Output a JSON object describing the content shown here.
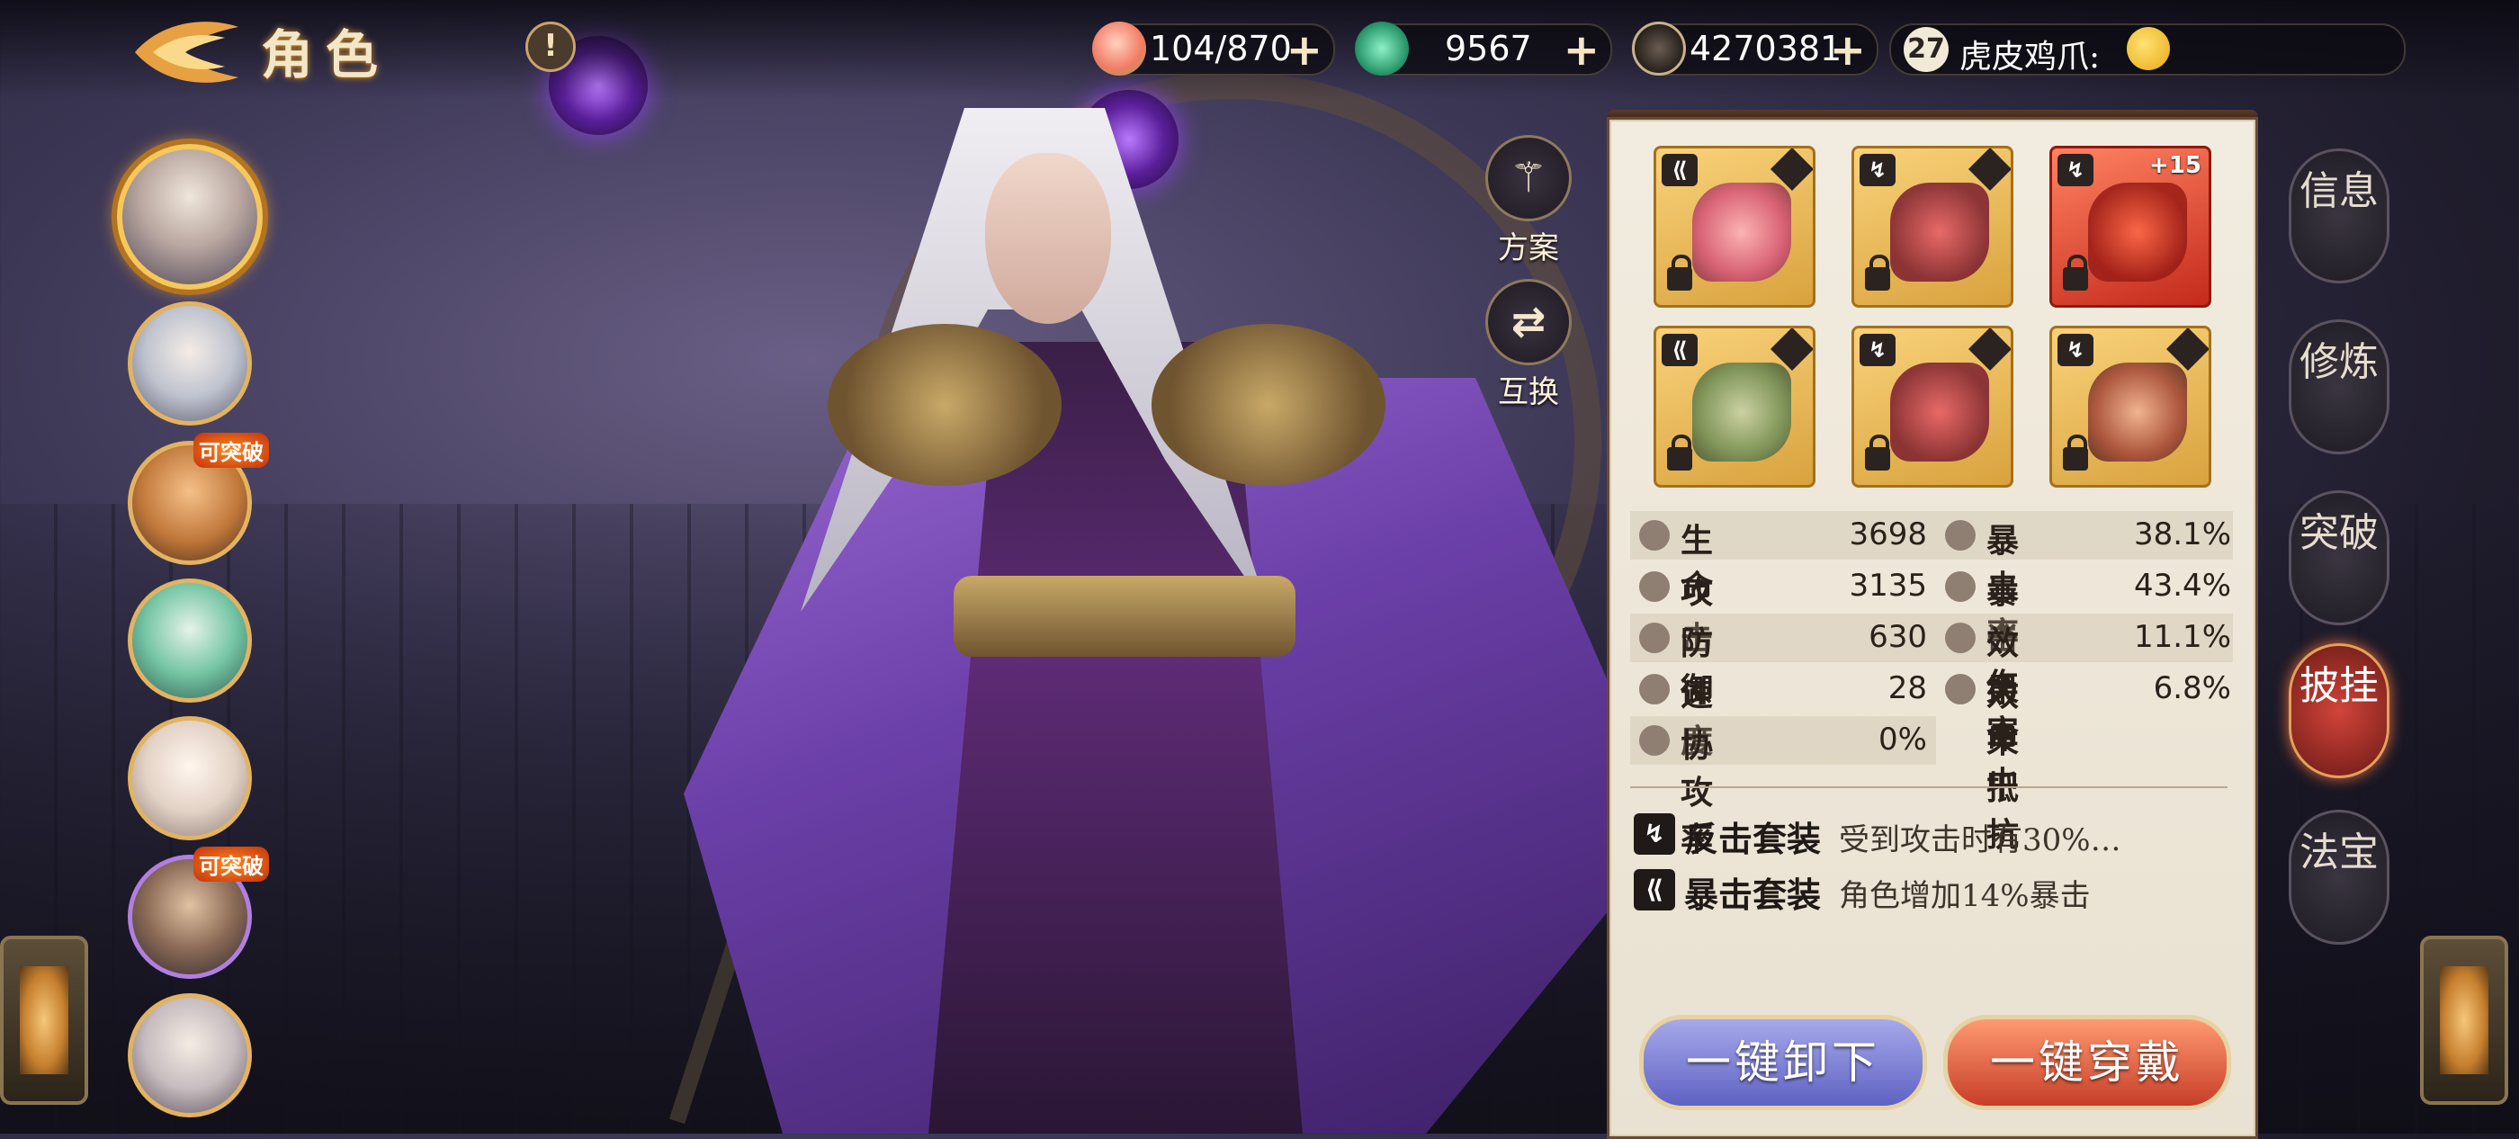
{
  "header": {
    "title": "角色",
    "alert": "!"
  },
  "resources": [
    {
      "icon": "peach-icon",
      "value": "104/870",
      "plus": "+"
    },
    {
      "icon": "jade-swirl-icon",
      "value": "9567",
      "plus": "+"
    },
    {
      "icon": "coin-icon",
      "value": "4270381",
      "plus": "+"
    }
  ],
  "player": {
    "level": "27",
    "name": "虎皮鸡爪:"
  },
  "roster": [
    {
      "selected": true,
      "badge": ""
    },
    {
      "selected": false,
      "badge": ""
    },
    {
      "selected": false,
      "badge": "可突破"
    },
    {
      "selected": false,
      "badge": ""
    },
    {
      "selected": false,
      "badge": ""
    },
    {
      "selected": false,
      "badge": "可突破"
    },
    {
      "selected": false,
      "badge": ""
    }
  ],
  "side_actions": {
    "plan": "方案",
    "swap": "互换"
  },
  "equipment": [
    {
      "set": "crit",
      "rarity": "gold",
      "locked": true,
      "enhance": ""
    },
    {
      "set": "counter",
      "rarity": "gold",
      "locked": true,
      "enhance": ""
    },
    {
      "set": "counter",
      "rarity": "red",
      "locked": true,
      "enhance": "+15"
    },
    {
      "set": "crit",
      "rarity": "gold",
      "locked": true,
      "enhance": ""
    },
    {
      "set": "counter",
      "rarity": "gold",
      "locked": true,
      "enhance": ""
    },
    {
      "set": "counter",
      "rarity": "gold",
      "locked": true,
      "enhance": ""
    }
  ],
  "stats": {
    "hp": {
      "name": "生命",
      "value": "3698"
    },
    "attack": {
      "name": "攻击",
      "value": "3135"
    },
    "defense": {
      "name": "防御",
      "value": "630"
    },
    "speed": {
      "name": "速度",
      "value": "28"
    },
    "coop": {
      "name": "协攻率",
      "value": "0%"
    },
    "crit_rate": {
      "name": "暴击率",
      "value": "38.1%"
    },
    "crit_dmg": {
      "name": "暴击伤害",
      "value": "43.4%"
    },
    "effect_hit": {
      "name": "效果命中",
      "value": "11.1%"
    },
    "effect_res": {
      "name": "效果抵抗",
      "value": "6.8%"
    }
  },
  "sets": [
    {
      "name": "反击套装",
      "desc": "受到攻击时有30%…"
    },
    {
      "name": "暴击套装",
      "desc": "角色增加14%暴击"
    }
  ],
  "buttons": {
    "unequip_all": "一键卸下",
    "equip_all": "一键穿戴"
  },
  "tabs": [
    "信息",
    "修炼",
    "突破",
    "披挂",
    "法宝"
  ],
  "active_tab": "披挂",
  "colors": {
    "panel_bg": "#f2ece0",
    "active_tab": "#d2443a",
    "gold_slot": "#f9d27a",
    "red_slot": "#ff8262"
  }
}
